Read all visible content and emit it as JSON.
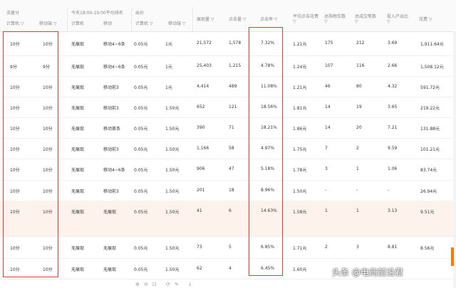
{
  "header": {
    "group1": "流量分",
    "group2": "今天18:00-19:00平均排名",
    "group3": "出价",
    "cols": [
      "计算机 ▽",
      "移动端 ▽",
      "计算机",
      "移动",
      "计算机 ▽",
      "移动端 ▽",
      "展现量 ▽",
      "点击量 ▽",
      "点击率 ▽",
      "平均点击花费 ▽",
      "总购物车数 ▽",
      "总成交笔数 ▽",
      "投入产出比 ▽",
      "花费 ▽"
    ]
  },
  "rows": [
    [
      "10分",
      "10分",
      "无展现",
      "移动4~6条",
      "0.05元",
      "1元",
      "21,572",
      "1,578",
      "7.32%",
      "1.21元",
      "175",
      "212",
      "3.69",
      "1,911.64元"
    ],
    [
      "9分",
      "9分",
      "无展现",
      "移动4~6条",
      "0.05元",
      "1元",
      "25,403",
      "1,215",
      "4.78%",
      "1.24元",
      "107",
      "116",
      "2.66",
      "1,508.12元"
    ],
    [
      "10分",
      "10分",
      "无展现",
      "移动前3",
      "0.05元",
      "1元",
      "4,414",
      "489",
      "11.08%",
      "1.21元",
      "46",
      "80",
      "4.32",
      "591.72元"
    ],
    [
      "10分",
      "10分",
      "无展现",
      "移动前3",
      "0.05元",
      "1.50元",
      "652",
      "121",
      "18.56%",
      "1.81元",
      "14",
      "19",
      "3.65",
      "219.22元"
    ],
    [
      "10分",
      "10分",
      "无展现",
      "移动首条",
      "0.05元",
      "1.50元",
      "390",
      "71",
      "18.21%",
      "1.86元",
      "14",
      "20",
      "7.21",
      "131.88元"
    ],
    [
      "10分",
      "10分",
      "无展现",
      "移动前3",
      "0.05元",
      "1.50元",
      "1,166",
      "58",
      "4.97%",
      "1.75元",
      "7",
      "2",
      "9.59",
      "101.21元"
    ],
    [
      "10分",
      "10分",
      "无展现",
      "移动4~6条",
      "0.05元",
      "1.50元",
      "906",
      "47",
      "5.18%",
      "1.78元",
      "3",
      "1",
      "1.06",
      "83.74元"
    ],
    [
      "10分",
      "10分",
      "无展现",
      "移动前3",
      "0.05元",
      "1.50元",
      "201",
      "18",
      "8.96%",
      "1.50元",
      "-",
      "-",
      "-",
      "26.94元"
    ],
    [
      "10分",
      "10分",
      "无展现",
      "无展现",
      "0.05元",
      "1.50元",
      "41",
      "6",
      "14.63%",
      "1.58元",
      "1",
      "1",
      "3.13",
      "9.51元"
    ],
    [
      "",
      "",
      "",
      "",
      "",
      "",
      "",
      "",
      "",
      "",
      "",
      "",
      "",
      ""
    ],
    [
      "10分",
      "10分",
      "无展现",
      "无展现",
      "0.05元",
      "1.50元",
      "73",
      "5",
      "6.85%",
      "1.71元",
      "2",
      "3",
      "8.81",
      "8.56元"
    ],
    [
      "10分",
      "10分",
      "无展现",
      "无展现",
      "0.05元",
      "1.50元",
      "62",
      "4",
      "6.45%",
      "1.60元",
      "",
      "",
      "",
      ""
    ]
  ],
  "pager": [
    "⊕",
    "⊖",
    "⊡",
    "⟳",
    "✎",
    "↓"
  ],
  "watermark": "头条 @电商前沿君",
  "colors": {
    "highlight_box": "#e53935",
    "scroll_marker": "#f57c00"
  }
}
